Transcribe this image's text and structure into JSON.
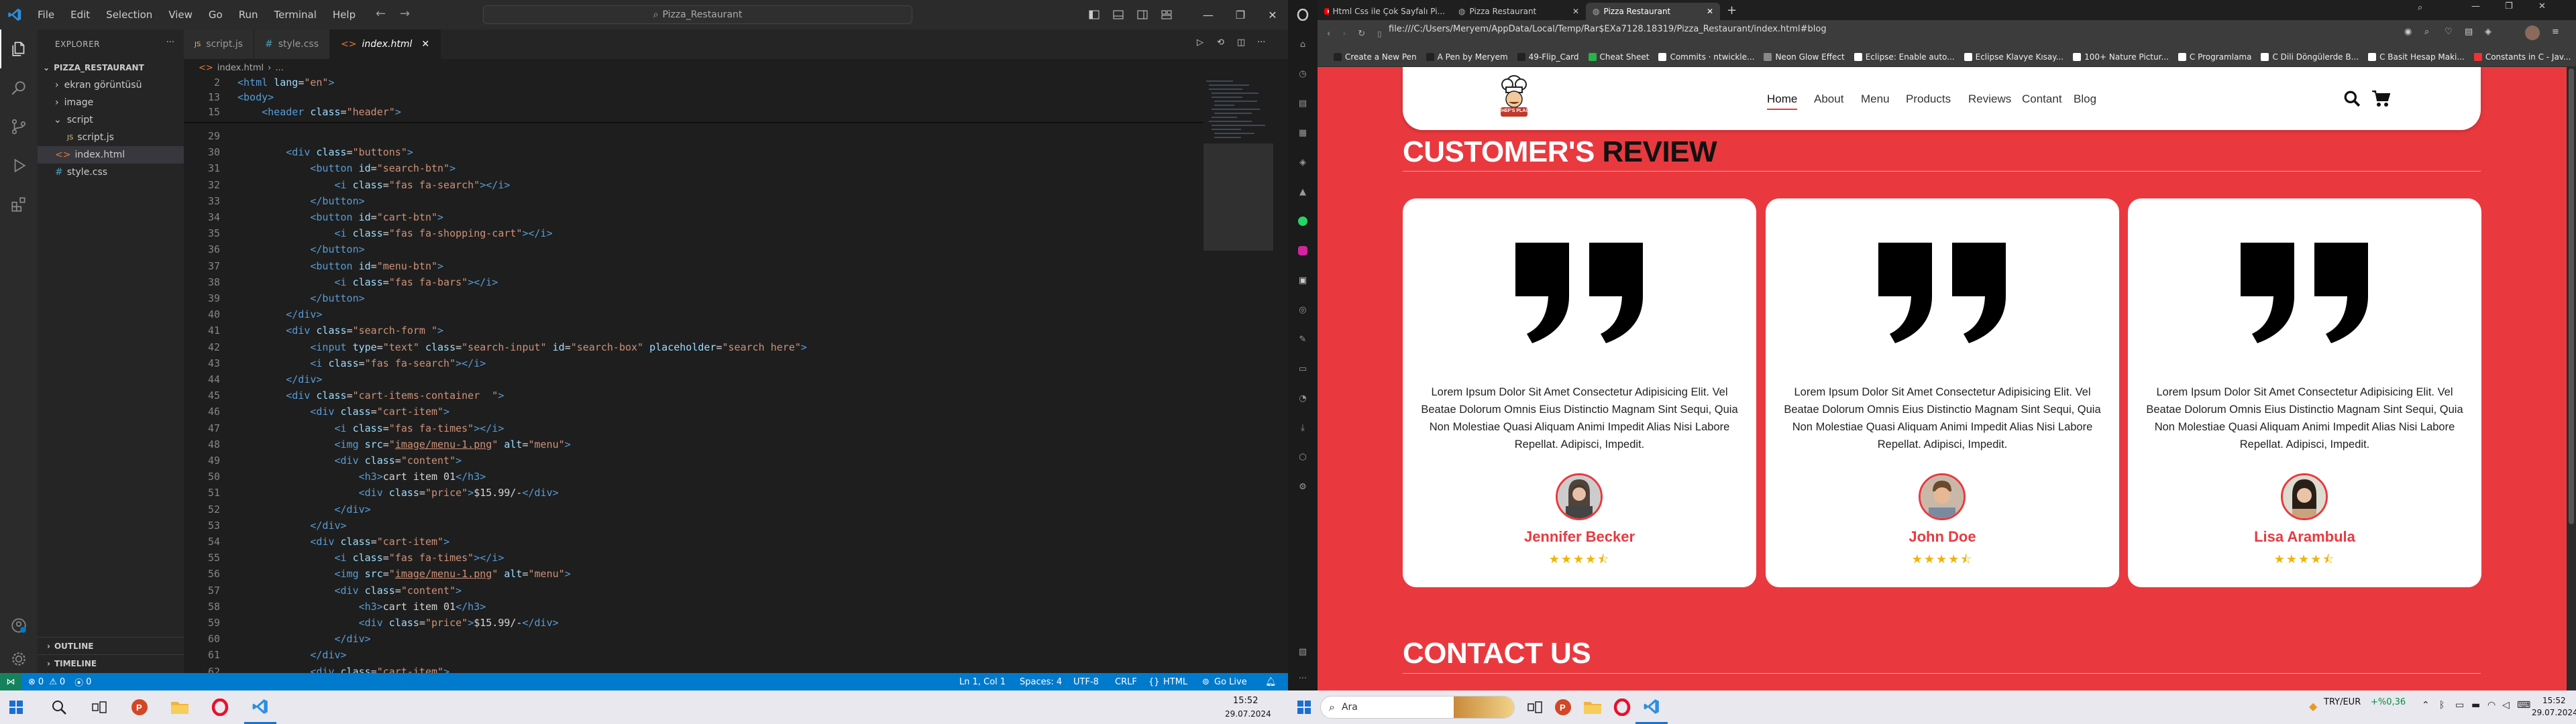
{
  "vscode": {
    "menu": [
      "File",
      "Edit",
      "Selection",
      "View",
      "Go",
      "Run",
      "Terminal",
      "Help"
    ],
    "search": "Pizza_Restaurant",
    "explorer": {
      "title": "EXPLORER",
      "root": "PIZZA_RESTAURANT",
      "items": [
        {
          "label": "ekran görüntüsü",
          "type": "folder"
        },
        {
          "label": "image",
          "type": "folder"
        },
        {
          "label": "script",
          "type": "folder-open"
        },
        {
          "label": "script.js",
          "type": "js"
        },
        {
          "label": "index.html",
          "type": "html"
        },
        {
          "label": "style.css",
          "type": "css"
        }
      ],
      "outline": "OUTLINE",
      "timeline": "TIMELINE"
    },
    "tabs": [
      {
        "label": "script.js",
        "icon": "JS"
      },
      {
        "label": "style.css",
        "icon": "#"
      },
      {
        "label": "index.html",
        "icon": "<>",
        "active": true
      }
    ],
    "breadcrumb": [
      "index.html",
      "..."
    ],
    "sticky": [
      {
        "n": "2",
        "html": "<span class='t-tag'>&lt;html</span> <span class='t-attr'>lang</span>=<span class='t-str'>\"en\"</span><span class='t-tag'>&gt;</span>"
      },
      {
        "n": "13",
        "html": "<span class='t-tag'>&lt;body&gt;</span>"
      },
      {
        "n": "15",
        "html": "    <span class='t-tag'>&lt;header</span> <span class='t-attr'>class</span>=<span class='t-str'>\"header\"</span><span class='t-tag'>&gt;</span>"
      }
    ],
    "lines": [
      {
        "n": "29",
        "html": ""
      },
      {
        "n": "30",
        "html": "        <span class='t-tag'>&lt;div</span> <span class='t-attr'>class</span>=<span class='t-str'>\"buttons\"</span><span class='t-tag'>&gt;</span>"
      },
      {
        "n": "31",
        "html": "            <span class='t-tag'>&lt;button</span> <span class='t-attr'>id</span>=<span class='t-str'>\"search-btn\"</span><span class='t-tag'>&gt;</span>"
      },
      {
        "n": "32",
        "html": "                <span class='t-tag'>&lt;i</span> <span class='t-attr'>class</span>=<span class='t-str'>\"fas fa-search\"</span><span class='t-tag'>&gt;&lt;/i&gt;</span>"
      },
      {
        "n": "33",
        "html": "            <span class='t-tag'>&lt;/button&gt;</span>"
      },
      {
        "n": "34",
        "html": "            <span class='t-tag'>&lt;button</span> <span class='t-attr'>id</span>=<span class='t-str'>\"cart-btn\"</span><span class='t-tag'>&gt;</span>"
      },
      {
        "n": "35",
        "html": "                <span class='t-tag'>&lt;i</span> <span class='t-attr'>class</span>=<span class='t-str'>\"fas fa-shopping-cart\"</span><span class='t-tag'>&gt;&lt;/i&gt;</span>"
      },
      {
        "n": "36",
        "html": "            <span class='t-tag'>&lt;/button&gt;</span>"
      },
      {
        "n": "37",
        "html": "            <span class='t-tag'>&lt;button</span> <span class='t-attr'>id</span>=<span class='t-str'>\"menu-btn\"</span><span class='t-tag'>&gt;</span>"
      },
      {
        "n": "38",
        "html": "                <span class='t-tag'>&lt;i</span> <span class='t-attr'>class</span>=<span class='t-str'>\"fas fa-bars\"</span><span class='t-tag'>&gt;&lt;/i&gt;</span>"
      },
      {
        "n": "39",
        "html": "            <span class='t-tag'>&lt;/button&gt;</span>"
      },
      {
        "n": "40",
        "html": "        <span class='t-tag'>&lt;/div&gt;</span>"
      },
      {
        "n": "41",
        "html": "        <span class='t-tag'>&lt;div</span> <span class='t-attr'>class</span>=<span class='t-str'>\"search-form \"</span><span class='t-tag'>&gt;</span>"
      },
      {
        "n": "42",
        "html": "            <span class='t-tag'>&lt;input</span> <span class='t-attr'>type</span>=<span class='t-str'>\"text\"</span> <span class='t-attr'>class</span>=<span class='t-str'>\"search-input\"</span> <span class='t-attr'>id</span>=<span class='t-str'>\"search-box\"</span> <span class='t-attr'>placeholder</span>=<span class='t-str'>\"search here\"</span><span class='t-tag'>&gt;</span>"
      },
      {
        "n": "43",
        "html": "            <span class='t-tag'>&lt;i</span> <span class='t-attr'>class</span>=<span class='t-str'>\"fas fa-search\"</span><span class='t-tag'>&gt;&lt;/i&gt;</span>"
      },
      {
        "n": "44",
        "html": "        <span class='t-tag'>&lt;/div&gt;</span>"
      },
      {
        "n": "45",
        "html": "        <span class='t-tag'>&lt;div</span> <span class='t-attr'>class</span>=<span class='t-str'>\"cart-items-container  \"</span><span class='t-tag'>&gt;</span>"
      },
      {
        "n": "46",
        "html": "            <span class='t-tag'>&lt;div</span> <span class='t-attr'>class</span>=<span class='t-str'>\"cart-item\"</span><span class='t-tag'>&gt;</span>"
      },
      {
        "n": "47",
        "html": "                <span class='t-tag'>&lt;i</span> <span class='t-attr'>class</span>=<span class='t-str'>\"fas fa-times\"</span><span class='t-tag'>&gt;&lt;/i&gt;</span>"
      },
      {
        "n": "48",
        "html": "                <span class='t-tag'>&lt;img</span> <span class='t-attr'>src</span>=<span class='t-str'>\"<u>image/menu-1.png</u>\"</span> <span class='t-attr'>alt</span>=<span class='t-str'>\"menu\"</span><span class='t-tag'>&gt;</span>"
      },
      {
        "n": "49",
        "html": "                <span class='t-tag'>&lt;div</span> <span class='t-attr'>class</span>=<span class='t-str'>\"content\"</span><span class='t-tag'>&gt;</span>"
      },
      {
        "n": "50",
        "html": "                    <span class='t-tag'>&lt;h3&gt;</span>cart item 01<span class='t-tag'>&lt;/h3&gt;</span>"
      },
      {
        "n": "51",
        "html": "                    <span class='t-tag'>&lt;div</span> <span class='t-attr'>class</span>=<span class='t-str'>\"price\"</span><span class='t-tag'>&gt;</span>$15.99/-<span class='t-tag'>&lt;/div&gt;</span>"
      },
      {
        "n": "52",
        "html": "                <span class='t-tag'>&lt;/div&gt;</span>"
      },
      {
        "n": "53",
        "html": "            <span class='t-tag'>&lt;/div&gt;</span>"
      },
      {
        "n": "54",
        "html": "            <span class='t-tag'>&lt;div</span> <span class='t-attr'>class</span>=<span class='t-str'>\"cart-item\"</span><span class='t-tag'>&gt;</span>"
      },
      {
        "n": "55",
        "html": "                <span class='t-tag'>&lt;i</span> <span class='t-attr'>class</span>=<span class='t-str'>\"fas fa-times\"</span><span class='t-tag'>&gt;&lt;/i&gt;</span>"
      },
      {
        "n": "56",
        "html": "                <span class='t-tag'>&lt;img</span> <span class='t-attr'>src</span>=<span class='t-str'>\"<u>image/menu-1.png</u>\"</span> <span class='t-attr'>alt</span>=<span class='t-str'>\"menu\"</span><span class='t-tag'>&gt;</span>"
      },
      {
        "n": "57",
        "html": "                <span class='t-tag'>&lt;div</span> <span class='t-attr'>class</span>=<span class='t-str'>\"content\"</span><span class='t-tag'>&gt;</span>"
      },
      {
        "n": "58",
        "html": "                    <span class='t-tag'>&lt;h3&gt;</span>cart item 01<span class='t-tag'>&lt;/h3&gt;</span>"
      },
      {
        "n": "59",
        "html": "                    <span class='t-tag'>&lt;div</span> <span class='t-attr'>class</span>=<span class='t-str'>\"price\"</span><span class='t-tag'>&gt;</span>$15.99/-<span class='t-tag'>&lt;/div&gt;</span>"
      },
      {
        "n": "60",
        "html": "                <span class='t-tag'>&lt;/div&gt;</span>"
      },
      {
        "n": "61",
        "html": "            <span class='t-tag'>&lt;/div&gt;</span>"
      },
      {
        "n": "62",
        "html": "            <span class='t-tag'>&lt;div</span> <span class='t-attr'>class</span>=<span class='t-str'>\"cart-item\"</span><span class='t-tag'>&gt;</span>"
      }
    ],
    "status": {
      "errors": "0",
      "warnings": "0",
      "ports": "0",
      "position": "Ln 1, Col 1",
      "spaces": "Spaces: 4",
      "encoding": "UTF-8",
      "eol": "CRLF",
      "language": "HTML",
      "golive": "Go Live"
    }
  },
  "browser": {
    "tabs": [
      {
        "label": "Html Css ile Çok Sayfalı Pi..."
      },
      {
        "label": "Pizza Restaurant"
      },
      {
        "label": "Pizza Restaurant",
        "active": true
      }
    ],
    "url": "file:///C:/Users/Meryem/AppData/Local/Temp/Rar$EXa7128.18319/Pizza_Restaurant/index.html#blog",
    "bookmarks": [
      {
        "label": "Create a New Pen",
        "color": "#222"
      },
      {
        "label": "A Pen by Meryem",
        "color": "#222"
      },
      {
        "label": "49-Flip_Card",
        "color": "#222"
      },
      {
        "label": "Cheat Sheet",
        "color": "#2bb24c"
      },
      {
        "label": "Commits · ntwickle...",
        "color": "#fff"
      },
      {
        "label": "Neon Glow Effect",
        "color": "#888"
      },
      {
        "label": "Eclipse: Enable auto...",
        "color": "#fff"
      },
      {
        "label": "Eclipse Klavye Kısay...",
        "color": "#fff"
      },
      {
        "label": "100+ Nature Pictur...",
        "color": "#fff"
      },
      {
        "label": "C Programlama",
        "color": "#fff"
      },
      {
        "label": "C Dili Döngülerde B...",
        "color": "#fff"
      },
      {
        "label": "C Basit Hesap Maki...",
        "color": "#fff"
      },
      {
        "label": "Constants in C - Jav...",
        "color": "#e33"
      }
    ]
  },
  "site": {
    "logo_text": "CHEF'S PLACE",
    "nav": [
      "Home",
      "About",
      "Menu",
      "Products",
      "Reviews",
      "Contant",
      "Blog"
    ],
    "review_title_a": "CUSTOMER'S",
    "review_title_b": "REVIEW",
    "reviews": [
      {
        "text": "Lorem Ipsum Dolor Sit Amet Consectetur Adipisicing Elit. Vel Beatae Dolorum Omnis Eius Distinctio Magnam Sint Sequi, Quia Non Molestiae Quasi Aliquam Animi Impedit Alias Nisi Labore Repellat. Adipisci, Impedit.",
        "name": "Jennifer Becker",
        "stars": "★★★★⯪"
      },
      {
        "text": "Lorem Ipsum Dolor Sit Amet Consectetur Adipisicing Elit. Vel Beatae Dolorum Omnis Eius Distinctio Magnam Sint Sequi, Quia Non Molestiae Quasi Aliquam Animi Impedit Alias Nisi Labore Repellat. Adipisci, Impedit.",
        "name": "John Doe",
        "stars": "★★★★⯪"
      },
      {
        "text": "Lorem Ipsum Dolor Sit Amet Consectetur Adipisicing Elit. Vel Beatae Dolorum Omnis Eius Distinctio Magnam Sint Sequi, Quia Non Molestiae Quasi Aliquam Animi Impedit Alias Nisi Labore Repellat. Adipisci, Impedit.",
        "name": "Lisa Arambula",
        "stars": "★★★★⯪"
      }
    ],
    "contact_title": "CONTACT US"
  },
  "taskbar": {
    "search_placeholder": "Ara",
    "currency": "TRY/EUR",
    "currency_change": "+%0,36",
    "left_time": "15:52",
    "left_date": "29.07.2024",
    "right_time": "15:52",
    "right_date": "29.07.2024"
  },
  "colors": {
    "accent": "#e9393f",
    "vs_status": "#007acc"
  }
}
